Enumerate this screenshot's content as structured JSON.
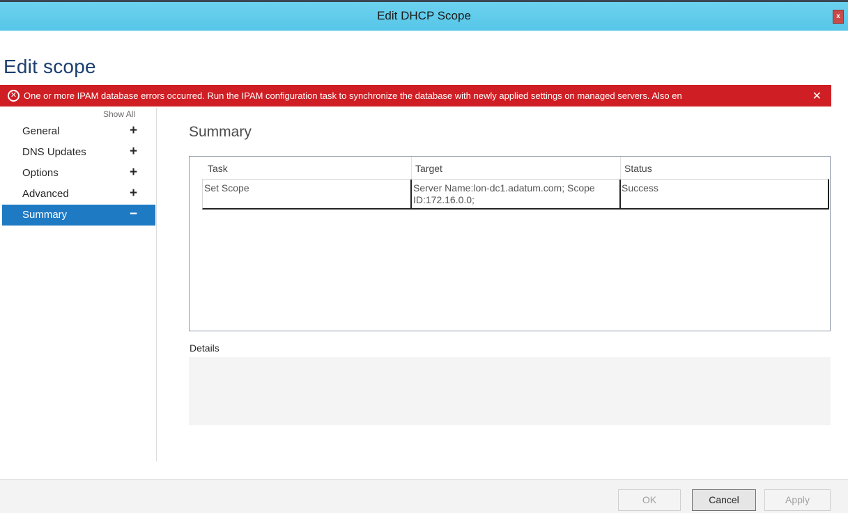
{
  "window": {
    "title": "Edit DHCP Scope",
    "close_glyph": "x"
  },
  "page": {
    "title": "Edit scope"
  },
  "error": {
    "icon": "error-circle-icon",
    "message": "One or more IPAM database errors occurred. Run the IPAM configuration task to synchronize the database with newly applied settings on managed servers. Also en",
    "close_glyph": "✕"
  },
  "nav": {
    "show_all": "Show All",
    "items": [
      {
        "label": "General",
        "sign": "+"
      },
      {
        "label": "DNS Updates",
        "sign": "+"
      },
      {
        "label": "Options",
        "sign": "+"
      },
      {
        "label": "Advanced",
        "sign": "+"
      },
      {
        "label": "Summary",
        "sign": "−",
        "active": true
      }
    ]
  },
  "summary": {
    "title": "Summary",
    "columns": [
      "Task",
      "Target",
      "Status"
    ],
    "rows": [
      {
        "task": "Set Scope",
        "target_line1": "Server Name:lon-dc1.adatum.com; Scope",
        "target_line2": "ID:172.16.0.0;",
        "status": "Success"
      }
    ],
    "details_label": "Details"
  },
  "footer": {
    "ok": "OK",
    "cancel": "Cancel",
    "apply": "Apply"
  },
  "colors": {
    "titlebar": "#57c6e8",
    "error": "#cf1f24",
    "active_nav": "#1f7ac4",
    "heading": "#1b3f6e"
  }
}
